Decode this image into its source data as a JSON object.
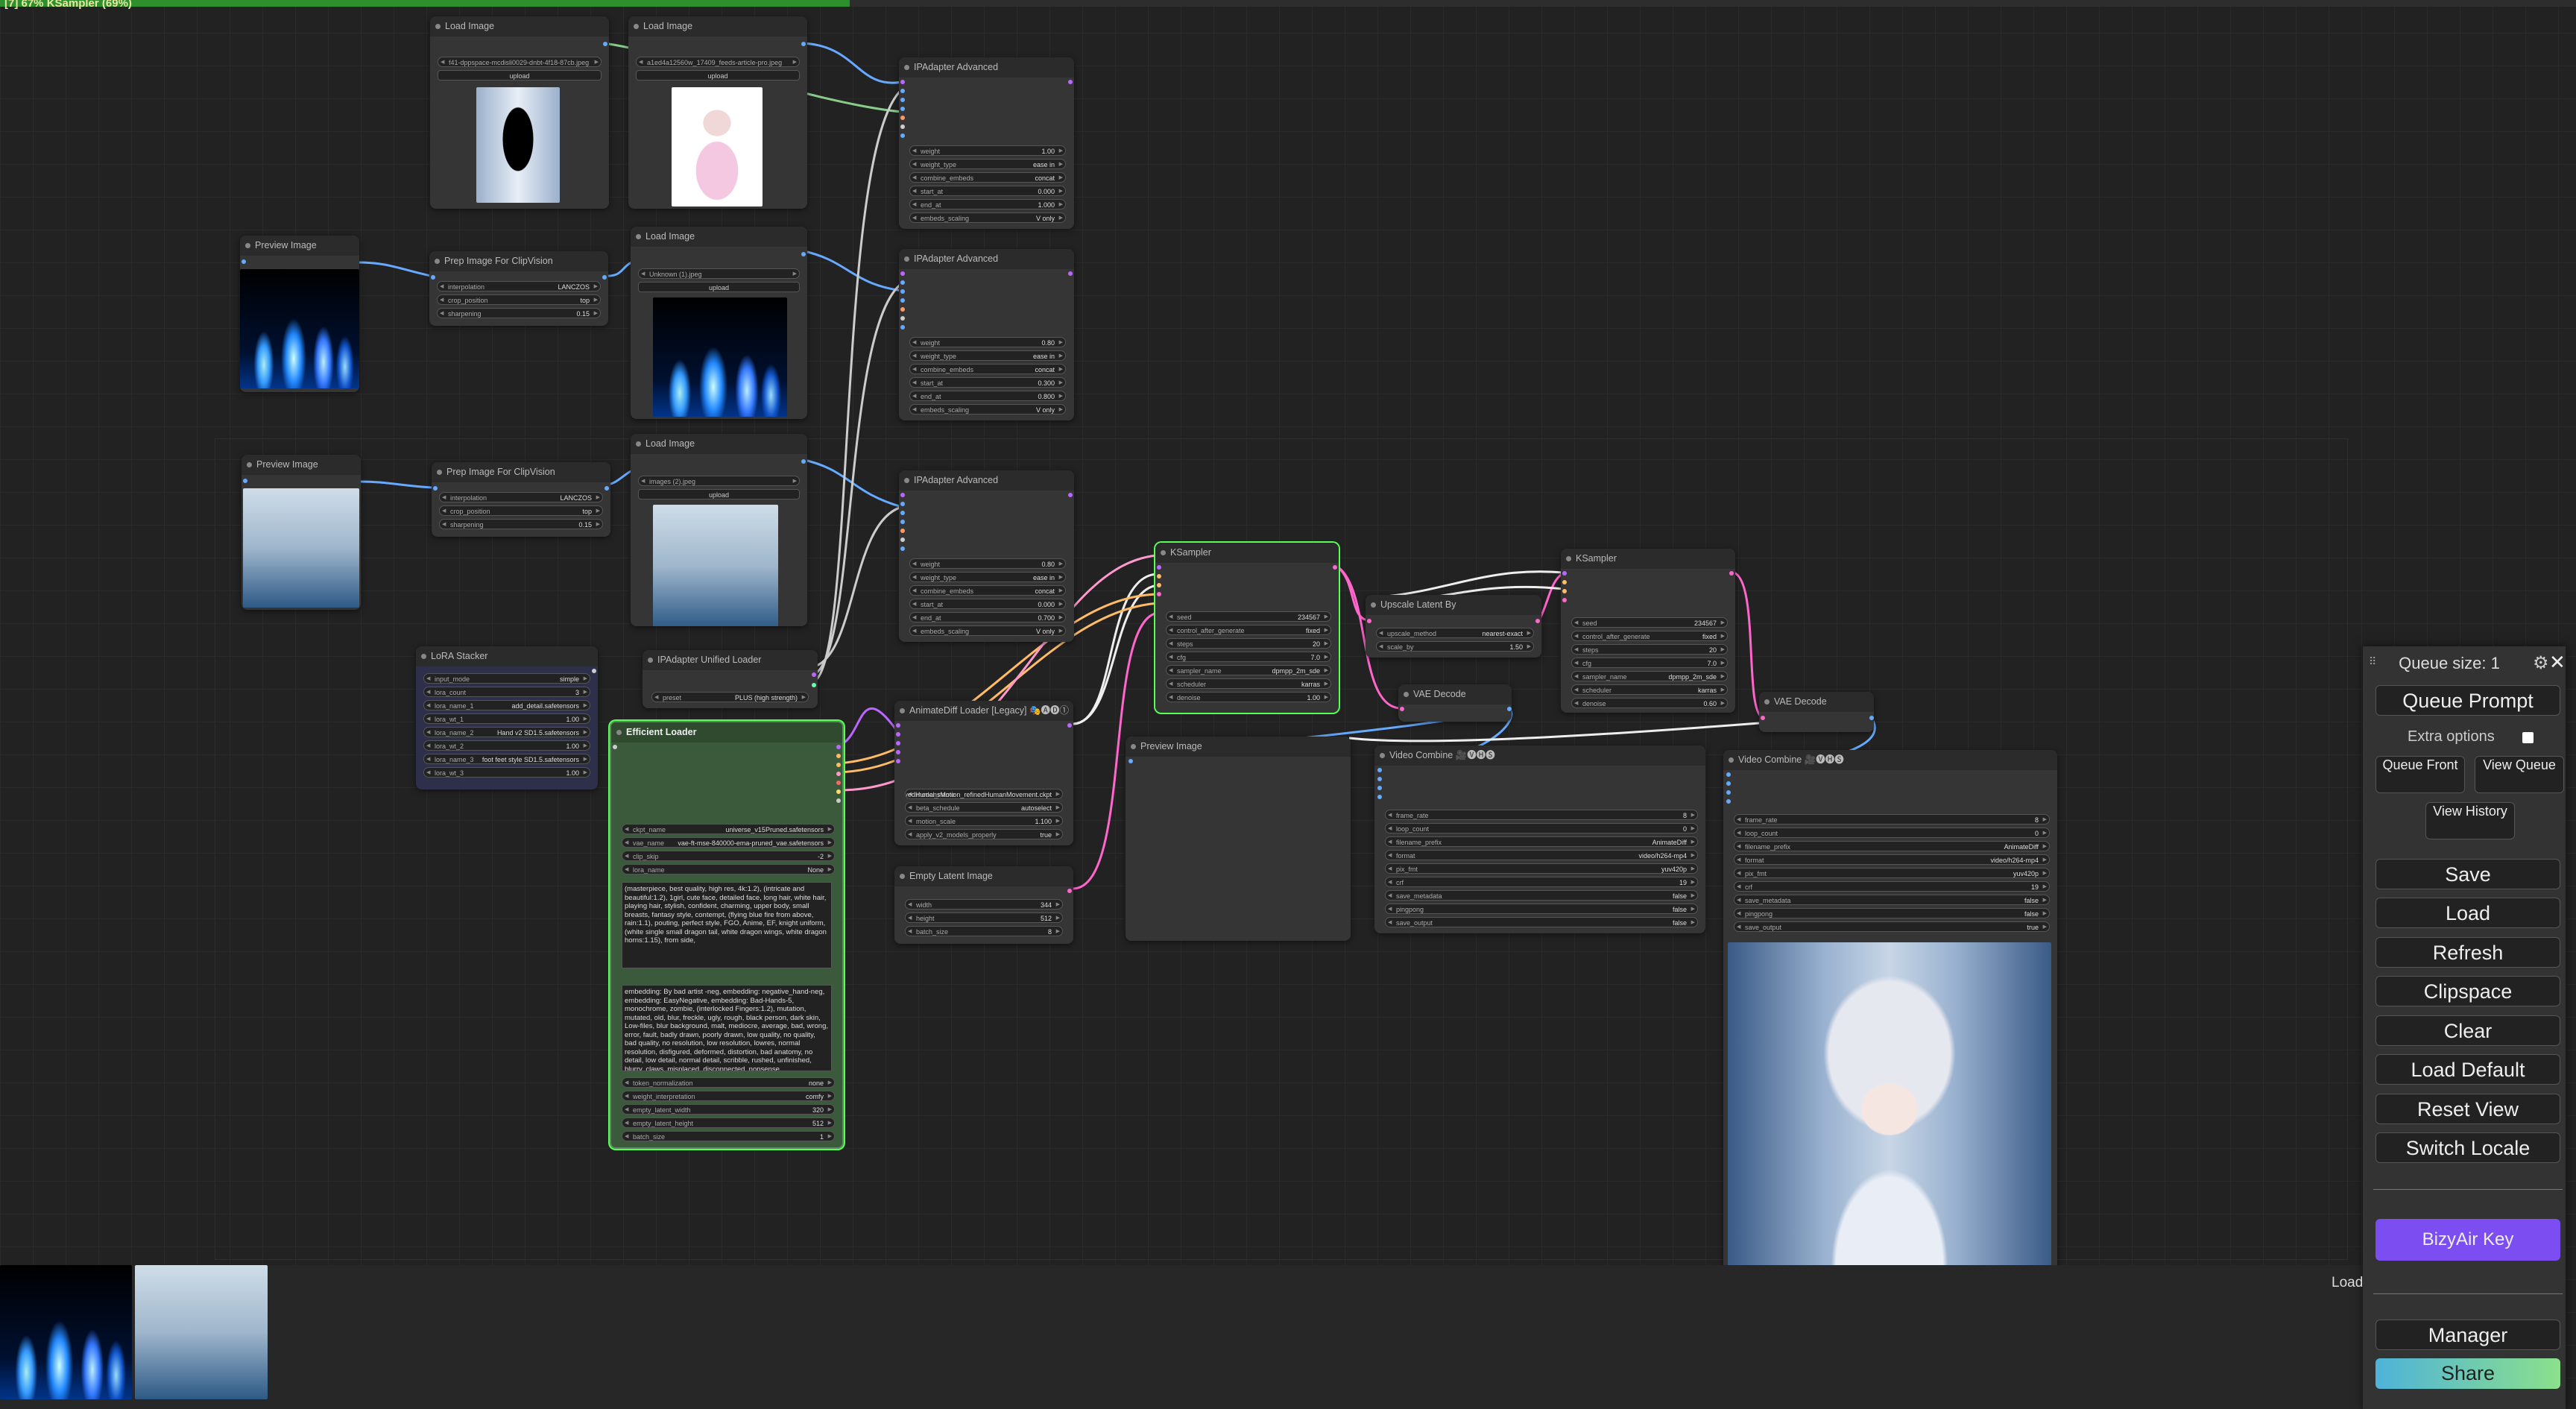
{
  "progress": {
    "text": "[7] 67% KSampler (69%)",
    "fraction": 0.33
  },
  "colors": {
    "accent_green": "#2e8f2e",
    "bizyair": "#7c4ef2",
    "share_start": "#4fb3d9",
    "share_end": "#8be08b"
  },
  "nodes": {
    "load_image_1": {
      "title": "Load Image",
      "image": "f41-dppspace-mcdisli0029-dnbt-4f18-87cb.jpeg",
      "upload": "upload"
    },
    "load_image_2": {
      "title": "Load Image",
      "image": "a1ed4a12560w_17409_feeds-article-pro.jpeg",
      "upload": "upload"
    },
    "load_image_3": {
      "title": "Load Image",
      "image_label": "image",
      "image": "Unknown (1).jpeg",
      "upload": "upload"
    },
    "load_image_4": {
      "title": "Load Image",
      "image_label": "image",
      "image": "images (2).jpeg",
      "upload": "upload"
    },
    "preview_1": {
      "title": "Preview Image"
    },
    "preview_2": {
      "title": "Preview Image"
    },
    "preview_3": {
      "title": "Preview Image"
    },
    "prep_1": {
      "title": "Prep Image For ClipVision",
      "w": [
        [
          "interpolation",
          "LANCZOS"
        ],
        [
          "crop_position",
          "top"
        ],
        [
          "sharpening",
          "0.15"
        ]
      ]
    },
    "prep_2": {
      "title": "Prep Image For ClipVision",
      "w": [
        [
          "interpolation",
          "LANCZOS"
        ],
        [
          "crop_position",
          "top"
        ],
        [
          "sharpening",
          "0.15"
        ]
      ]
    },
    "ipa_1": {
      "title": "IPAdapter Advanced",
      "w": [
        [
          "weight",
          "1.00"
        ],
        [
          "weight_type",
          "ease in"
        ],
        [
          "combine_embeds",
          "concat"
        ],
        [
          "start_at",
          "0.000"
        ],
        [
          "end_at",
          "1.000"
        ],
        [
          "embeds_scaling",
          "V only"
        ]
      ]
    },
    "ipa_2": {
      "title": "IPAdapter Advanced",
      "w": [
        [
          "weight",
          "0.80"
        ],
        [
          "weight_type",
          "ease in"
        ],
        [
          "combine_embeds",
          "concat"
        ],
        [
          "start_at",
          "0.300"
        ],
        [
          "end_at",
          "0.800"
        ],
        [
          "embeds_scaling",
          "V only"
        ]
      ]
    },
    "ipa_3": {
      "title": "IPAdapter Advanced",
      "w": [
        [
          "weight",
          "0.80"
        ],
        [
          "weight_type",
          "ease in"
        ],
        [
          "combine_embeds",
          "concat"
        ],
        [
          "start_at",
          "0.000"
        ],
        [
          "end_at",
          "0.700"
        ],
        [
          "embeds_scaling",
          "V only"
        ]
      ]
    },
    "ipa_loader": {
      "title": "IPAdapter Unified Loader",
      "w": [
        [
          "preset",
          "PLUS (high strength)"
        ]
      ]
    },
    "lora": {
      "title": "LoRA Stacker",
      "w": [
        [
          "input_mode",
          "simple"
        ],
        [
          "lora_count",
          "3"
        ],
        [
          "lora_name_1",
          "add_detail.safetensors"
        ],
        [
          "lora_wt_1",
          "1.00"
        ],
        [
          "lora_name_2",
          "Hand v2 SD1.5.safetensors"
        ],
        [
          "lora_wt_2",
          "1.00"
        ],
        [
          "lora_name_3",
          "foot feet style SD1.5.safetensors"
        ],
        [
          "lora_wt_3",
          "1.00"
        ]
      ]
    },
    "efficient": {
      "title": "Efficient Loader",
      "w": [
        [
          "ckpt_name",
          "universe_v15Pruned.safetensors"
        ],
        [
          "vae_name",
          "vae-ft-mse-840000-ema-pruned_vae.safetensors"
        ],
        [
          "clip_skip",
          "-2"
        ],
        [
          "lora_name",
          "None"
        ]
      ],
      "positive": "(masterpiece, best quality, high res, 4k:1.2), (intricate and beautiful:1.2), 1girl, cute face, detailed face, long hair, white hair, playing hair, stylish, confident, charming, upper body, small breasts, fantasy style, contempt, (flying blue fire from above, rain:1.1), pouting, perfect style, FGO, Anime, EF, knight uniform, (white single small dragon tail, white dragon wings, white dragon horns:1.15), from side,",
      "negative": "embedding: By bad artist -neg, embedding: negative_hand-neg, embedding: EasyNegative, embedding: Bad-Hands-5, monochrome, zombie, (interlocked Fingers:1.2), mutation, mutated, old, blur, freckle, ugly, rough, black person, dark skin, Low-files, blur background, malt, mediocre, average, bad, wrong, error, fault, badly drawn, poorly drawn, low quality, no quality, bad quality, no resolution, low resolution, lowres, normal resolution, disfigured, deformed, distortion, bad anatomy, no detail, low detail, normal detail, scribble, rushed, unfinished, blurry, claws, misplaced, disconnected, nonsense,",
      "w2": [
        [
          "token_normalization",
          "none"
        ],
        [
          "weight_interpretation",
          "comfy"
        ],
        [
          "empty_latent_width",
          "320"
        ],
        [
          "empty_latent_height",
          "512"
        ],
        [
          "batch_size",
          "1"
        ]
      ]
    },
    "animatediff": {
      "title": "AnimateDiff Loader [Legacy] 🎭🅐🅓①",
      "w": [
        [
          "model_name",
          "improvedHumansMotion_refinedHumanMovement.ckpt"
        ],
        [
          "beta_schedule",
          "autoselect"
        ],
        [
          "motion_scale",
          "1.100"
        ],
        [
          "apply_v2_models_properly",
          "true"
        ]
      ]
    },
    "empty_latent": {
      "title": "Empty Latent Image",
      "w": [
        [
          "width",
          "344"
        ],
        [
          "height",
          "512"
        ],
        [
          "batch_size",
          "8"
        ]
      ]
    },
    "ksampler_1": {
      "title": "KSampler",
      "w": [
        [
          "seed",
          "234567"
        ],
        [
          "control_after_generate",
          "fixed"
        ],
        [
          "steps",
          "20"
        ],
        [
          "cfg",
          "7.0"
        ],
        [
          "sampler_name",
          "dpmpp_2m_sde"
        ],
        [
          "scheduler",
          "karras"
        ],
        [
          "denoise",
          "1.00"
        ]
      ]
    },
    "ksampler_2": {
      "title": "KSampler",
      "w": [
        [
          "seed",
          "234567"
        ],
        [
          "control_after_generate",
          "fixed"
        ],
        [
          "steps",
          "20"
        ],
        [
          "cfg",
          "7.0"
        ],
        [
          "sampler_name",
          "dpmpp_2m_sde"
        ],
        [
          "scheduler",
          "karras"
        ],
        [
          "denoise",
          "0.60"
        ]
      ]
    },
    "upscale": {
      "title": "Upscale Latent By",
      "w": [
        [
          "upscale_method",
          "nearest-exact"
        ],
        [
          "scale_by",
          "1.50"
        ]
      ]
    },
    "vae_1": {
      "title": "VAE Decode"
    },
    "vae_2": {
      "title": "VAE Decode"
    },
    "video_1": {
      "title": "Video Combine 🎥🅥🅗🅢",
      "w": [
        [
          "frame_rate",
          "8"
        ],
        [
          "loop_count",
          "0"
        ],
        [
          "filename_prefix",
          "AnimateDiff"
        ],
        [
          "format",
          "video/h264-mp4"
        ],
        [
          "pix_fmt",
          "yuv420p"
        ],
        [
          "crf",
          "19"
        ],
        [
          "save_metadata",
          "false"
        ],
        [
          "pingpong",
          "false"
        ],
        [
          "save_output",
          "false"
        ]
      ]
    },
    "video_2": {
      "title": "Video Combine 🎥🅥🅗🅢",
      "w": [
        [
          "frame_rate",
          "8"
        ],
        [
          "loop_count",
          "0"
        ],
        [
          "filename_prefix",
          "AnimateDiff"
        ],
        [
          "format",
          "video/h264-mp4"
        ],
        [
          "pix_fmt",
          "yuv420p"
        ],
        [
          "crf",
          "19"
        ],
        [
          "save_metadata",
          "false"
        ],
        [
          "pingpong",
          "false"
        ],
        [
          "save_output",
          "true"
        ]
      ]
    }
  },
  "menu": {
    "queue_size": "Queue size: 1",
    "queue_prompt": "Queue Prompt",
    "extra_options": "Extra options",
    "queue_front": "Queue Front",
    "view_queue": "View Queue",
    "view_history": "View History",
    "save": "Save",
    "load": "Load",
    "refresh": "Refresh",
    "clipspace": "Clipspace",
    "clear": "Clear",
    "load_default": "Load Default",
    "reset_view": "Reset View",
    "switch_locale": "Switch Locale",
    "bizyair": "BizyAir Key",
    "load_side": "Load",
    "manager": "Manager",
    "share": "Share"
  }
}
